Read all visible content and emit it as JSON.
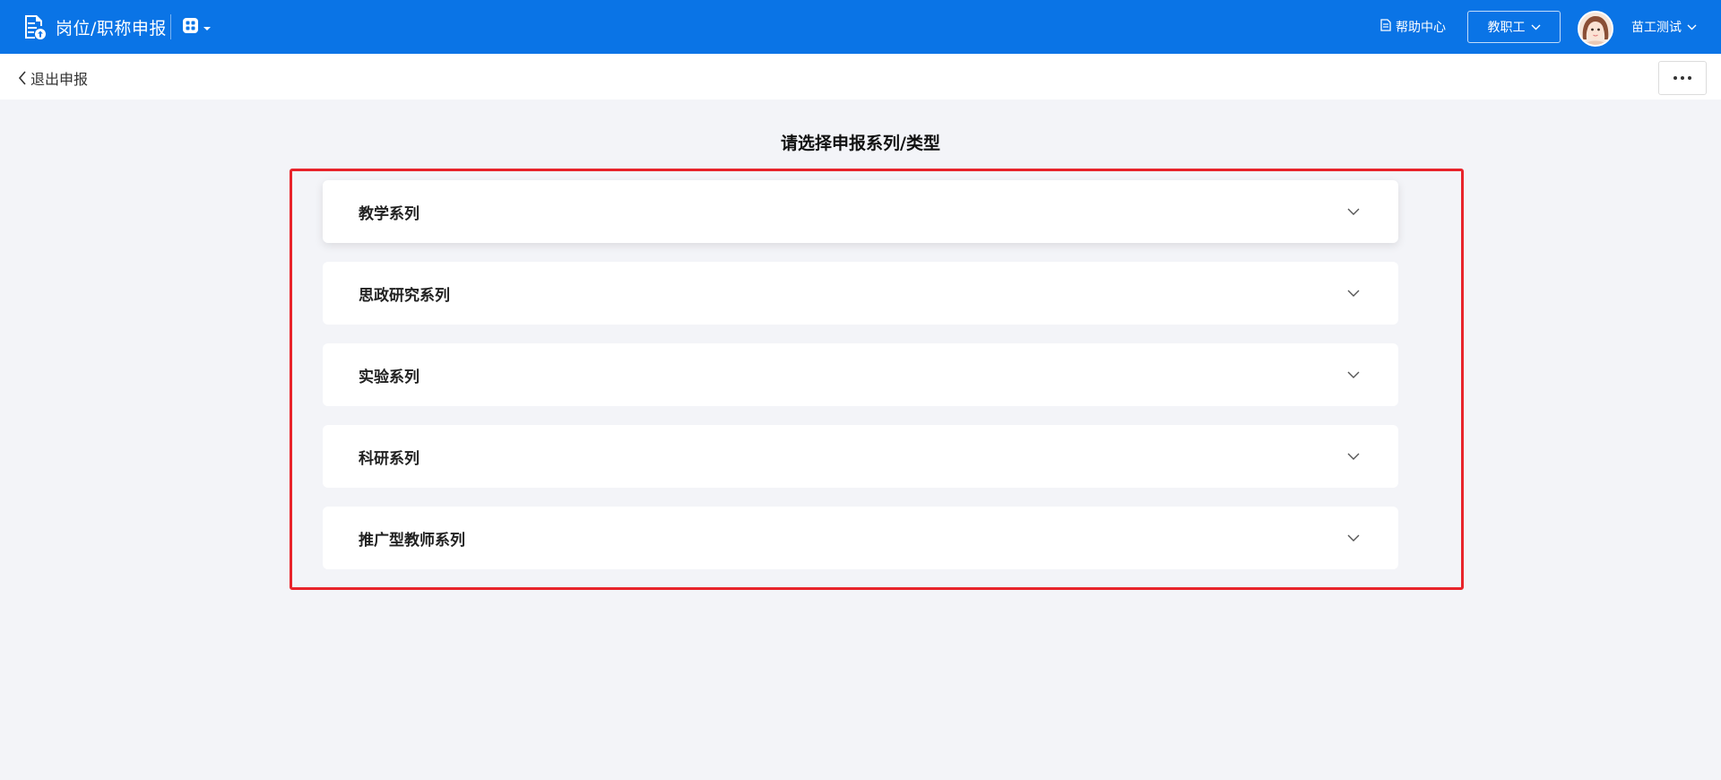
{
  "header": {
    "app_title": "岗位/职称申报",
    "help_label": "帮助中心",
    "role_label": "教职工",
    "user_name": "苗工测试"
  },
  "subheader": {
    "back_label": "退出申报"
  },
  "main": {
    "title": "请选择申报系列/类型",
    "series": [
      {
        "label": "教学系列"
      },
      {
        "label": "思政研究系列"
      },
      {
        "label": "实验系列"
      },
      {
        "label": "科研系列"
      },
      {
        "label": "推广型教师系列"
      }
    ]
  },
  "colors": {
    "header_bg": "#0a74e6",
    "page_bg": "#f3f4f8",
    "highlight": "#e8242b"
  },
  "icons": {
    "brand": "document-upload-icon",
    "switcher": "app-grid-icon",
    "help": "document-icon",
    "back": "chevron-left-icon",
    "more": "more-dots-icon",
    "expand": "chevron-down-icon"
  }
}
